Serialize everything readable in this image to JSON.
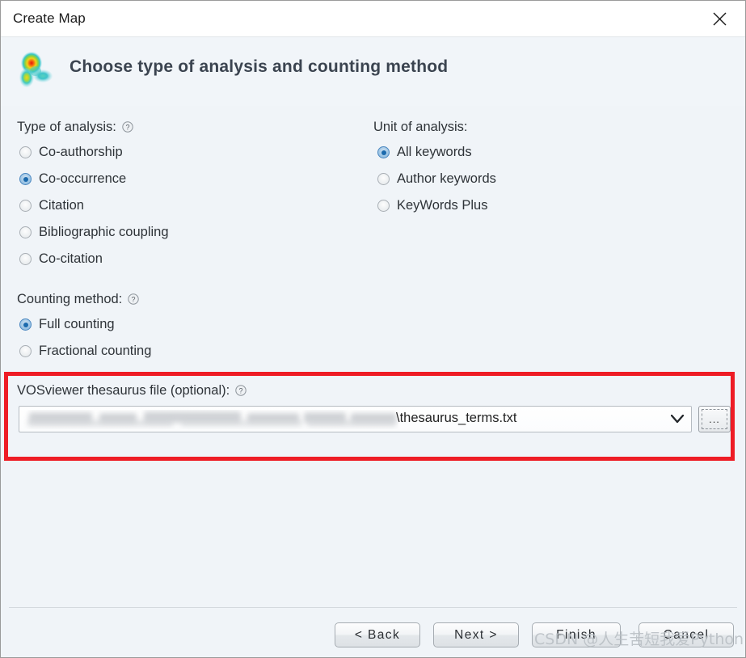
{
  "window": {
    "title": "Create Map",
    "close_icon": "close-icon"
  },
  "header": {
    "title": "Choose type of analysis and counting method",
    "logo_icon": "vosviewer-density-logo-icon"
  },
  "type_of_analysis": {
    "label": "Type of analysis:",
    "help_icon": "help-circle-icon",
    "options": [
      {
        "label": "Co-authorship",
        "selected": false
      },
      {
        "label": "Co-occurrence",
        "selected": true
      },
      {
        "label": "Citation",
        "selected": false
      },
      {
        "label": "Bibliographic coupling",
        "selected": false
      },
      {
        "label": "Co-citation",
        "selected": false
      }
    ]
  },
  "unit_of_analysis": {
    "label": "Unit of analysis:",
    "options": [
      {
        "label": "All keywords",
        "selected": true
      },
      {
        "label": "Author keywords",
        "selected": false
      },
      {
        "label": "KeyWords Plus",
        "selected": false
      }
    ]
  },
  "counting_method": {
    "label": "Counting method:",
    "help_icon": "help-circle-icon",
    "options": [
      {
        "label": "Full counting",
        "selected": true
      },
      {
        "label": "Fractional counting",
        "selected": false
      }
    ]
  },
  "thesaurus": {
    "label": "VOSviewer thesaurus file (optional):",
    "help_icon": "help-circle-icon",
    "combo_value_visible": "\\thesaurus_terms.txt",
    "combo_path_redacted": true,
    "dropdown_icon": "chevron-down-icon",
    "browse_button_label": "...",
    "highlight_color": "#ee1c25"
  },
  "footer": {
    "buttons": [
      {
        "label": "< Back"
      },
      {
        "label": "Next >"
      },
      {
        "label": "Finish"
      },
      {
        "label": "Cancel"
      }
    ]
  },
  "watermark": {
    "text": "CSDN @人生苦短我爱Python"
  }
}
